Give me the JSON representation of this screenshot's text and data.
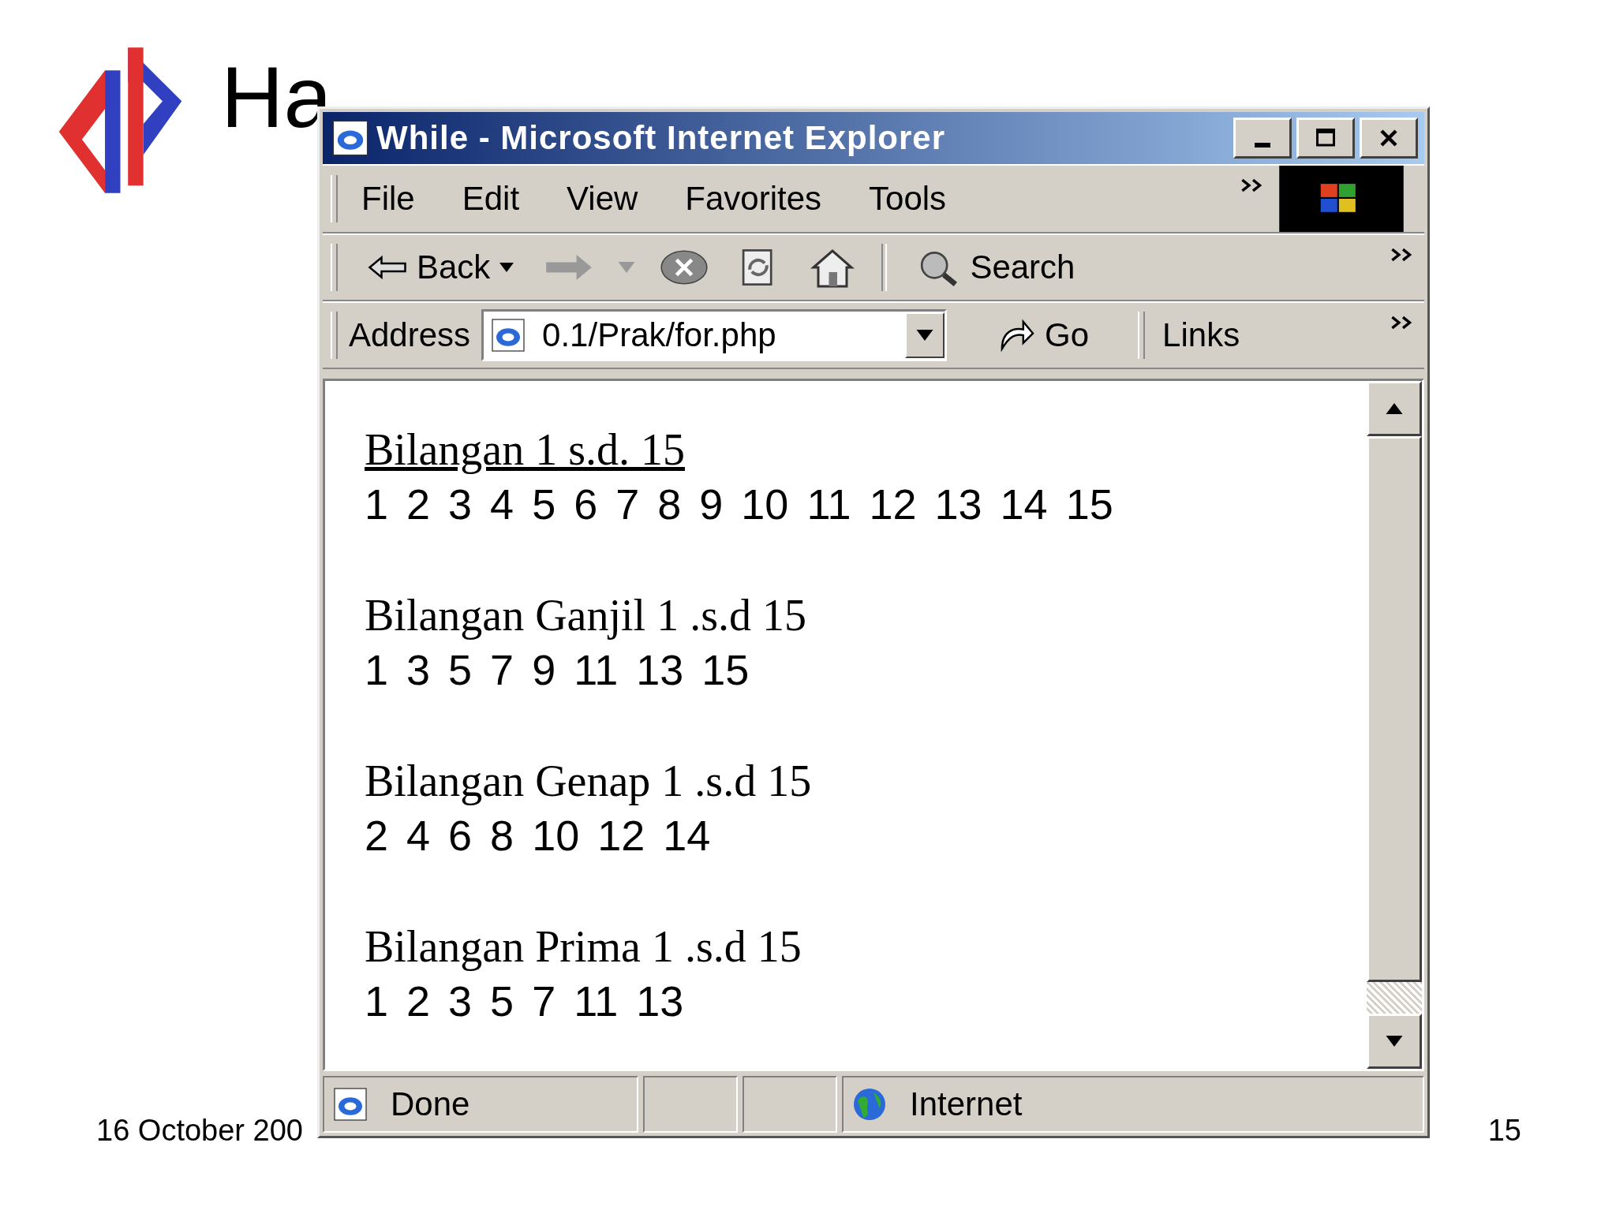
{
  "slide": {
    "title": "Ha",
    "footer_date": "16 October 200",
    "page_number": "15"
  },
  "window": {
    "title": "While - Microsoft Internet Explorer",
    "menu": [
      "File",
      "Edit",
      "View",
      "Favorites",
      "Tools"
    ],
    "toolbar": {
      "back": "Back",
      "search": "Search"
    },
    "address": {
      "label": "Address",
      "value": "0.1/Prak/for.php",
      "go": "Go",
      "links": "Links"
    },
    "sections": [
      {
        "heading": "Bilangan 1 s.d. 15",
        "link": true,
        "numbers": "1 2 3 4 5 6 7 8 9 10 11 12 13 14 15"
      },
      {
        "heading": "Bilangan Ganjil 1 .s.d 15",
        "link": false,
        "numbers": "1 3 5 7 9 11 13 15"
      },
      {
        "heading": "Bilangan Genap 1 .s.d 15",
        "link": false,
        "numbers": "2 4 6 8 10 12 14"
      },
      {
        "heading": "Bilangan Prima 1 .s.d 15",
        "link": false,
        "numbers": "1 2 3 5 7 11 13"
      }
    ],
    "status": {
      "text": "Done",
      "zone": "Internet"
    }
  }
}
